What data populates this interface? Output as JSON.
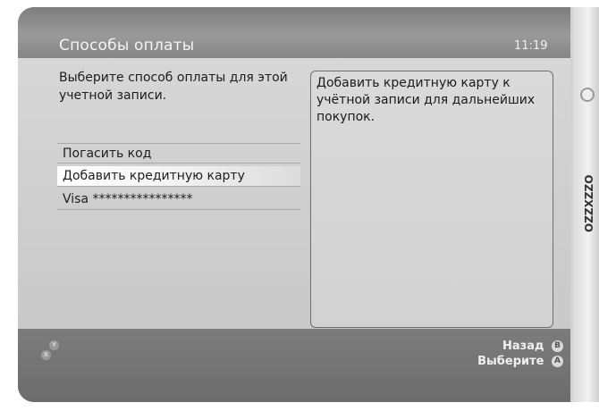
{
  "header": {
    "title": "Способы оплаты",
    "time": "11:19"
  },
  "main": {
    "prompt": "Выберите способ оплаты для этой учетной записи.",
    "menu_items": [
      {
        "label": "Погасить код"
      },
      {
        "label": "Добавить кредитную карту",
        "selected": true
      },
      {
        "label": "Visa ****************"
      }
    ],
    "description": "Добавить кредитную карту к учётной записи для дальнейших покупок."
  },
  "footer": {
    "left_buttons": [
      "Y",
      "X"
    ],
    "actions": [
      {
        "label": "Назад",
        "button": "B"
      },
      {
        "label": "Выберите",
        "button": "A"
      }
    ]
  },
  "blade": {
    "label": "OZZXZZO"
  }
}
